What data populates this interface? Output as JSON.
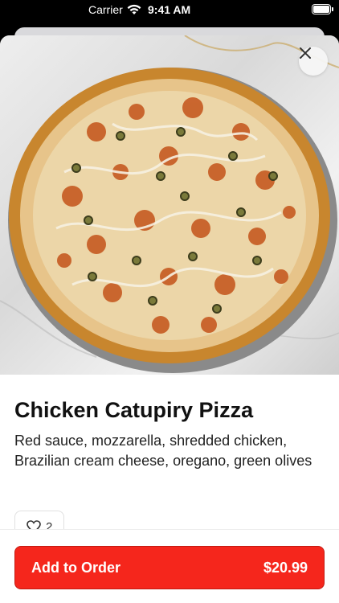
{
  "status_bar": {
    "carrier": "Carrier",
    "time": "9:41 AM"
  },
  "item": {
    "title": "Chicken Catupiry Pizza",
    "description": "Red sauce, mozzarella, shredded chicken, Brazilian cream cheese, oregano, green olives",
    "like_count": "2",
    "image_icon": "pizza-photo"
  },
  "footer": {
    "order_label": "Add to Order",
    "price": "$20.99"
  },
  "colors": {
    "accent": "#f5261c"
  }
}
